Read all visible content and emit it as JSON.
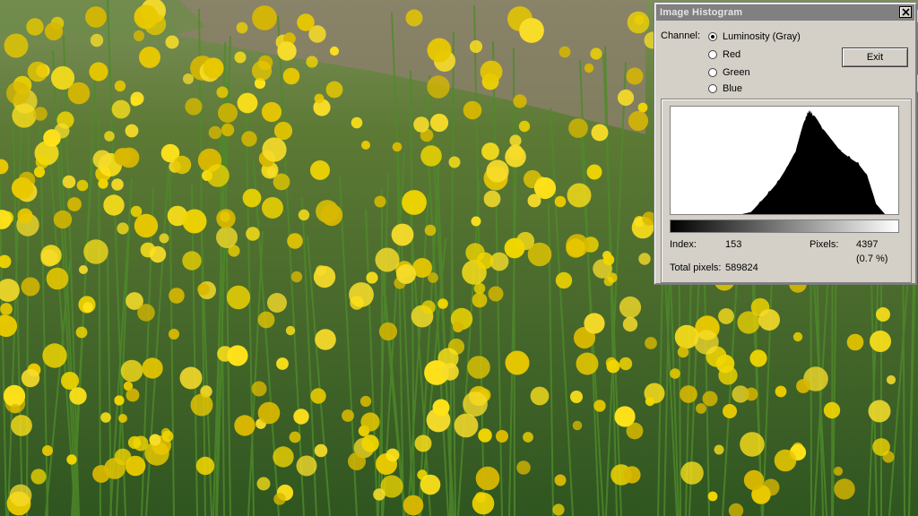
{
  "window": {
    "title": "Image Histogram",
    "exit_label": "Exit"
  },
  "channel": {
    "label": "Channel:",
    "options": [
      "Luminosity (Gray)",
      "Red",
      "Green",
      "Blue"
    ],
    "selected": "Luminosity (Gray)"
  },
  "info": {
    "index_label": "Index:",
    "index_value": "153",
    "pixels_label": "Pixels:",
    "pixels_value": "4397",
    "pixels_percent": "(0.7 %)",
    "total_label": "Total pixels:",
    "total_value": "589824"
  },
  "chart_data": {
    "type": "area",
    "x": [
      0,
      20,
      40,
      60,
      80,
      90,
      100,
      110,
      120,
      130,
      140,
      150,
      155,
      160,
      170,
      180,
      190,
      200,
      210,
      220,
      230,
      240,
      255
    ],
    "y": [
      0,
      0,
      0,
      0,
      0,
      0.02,
      0.12,
      0.22,
      0.32,
      0.45,
      0.6,
      0.9,
      1.0,
      0.95,
      0.82,
      0.72,
      0.62,
      0.56,
      0.5,
      0.38,
      0.1,
      0,
      0
    ],
    "xlim": [
      0,
      255
    ],
    "ylim": [
      0,
      1
    ],
    "fill_color": "#000000",
    "background_color": "#ffffff"
  },
  "colors": {
    "window_bg": "#d4d0c8",
    "title_bar": "#808080"
  }
}
